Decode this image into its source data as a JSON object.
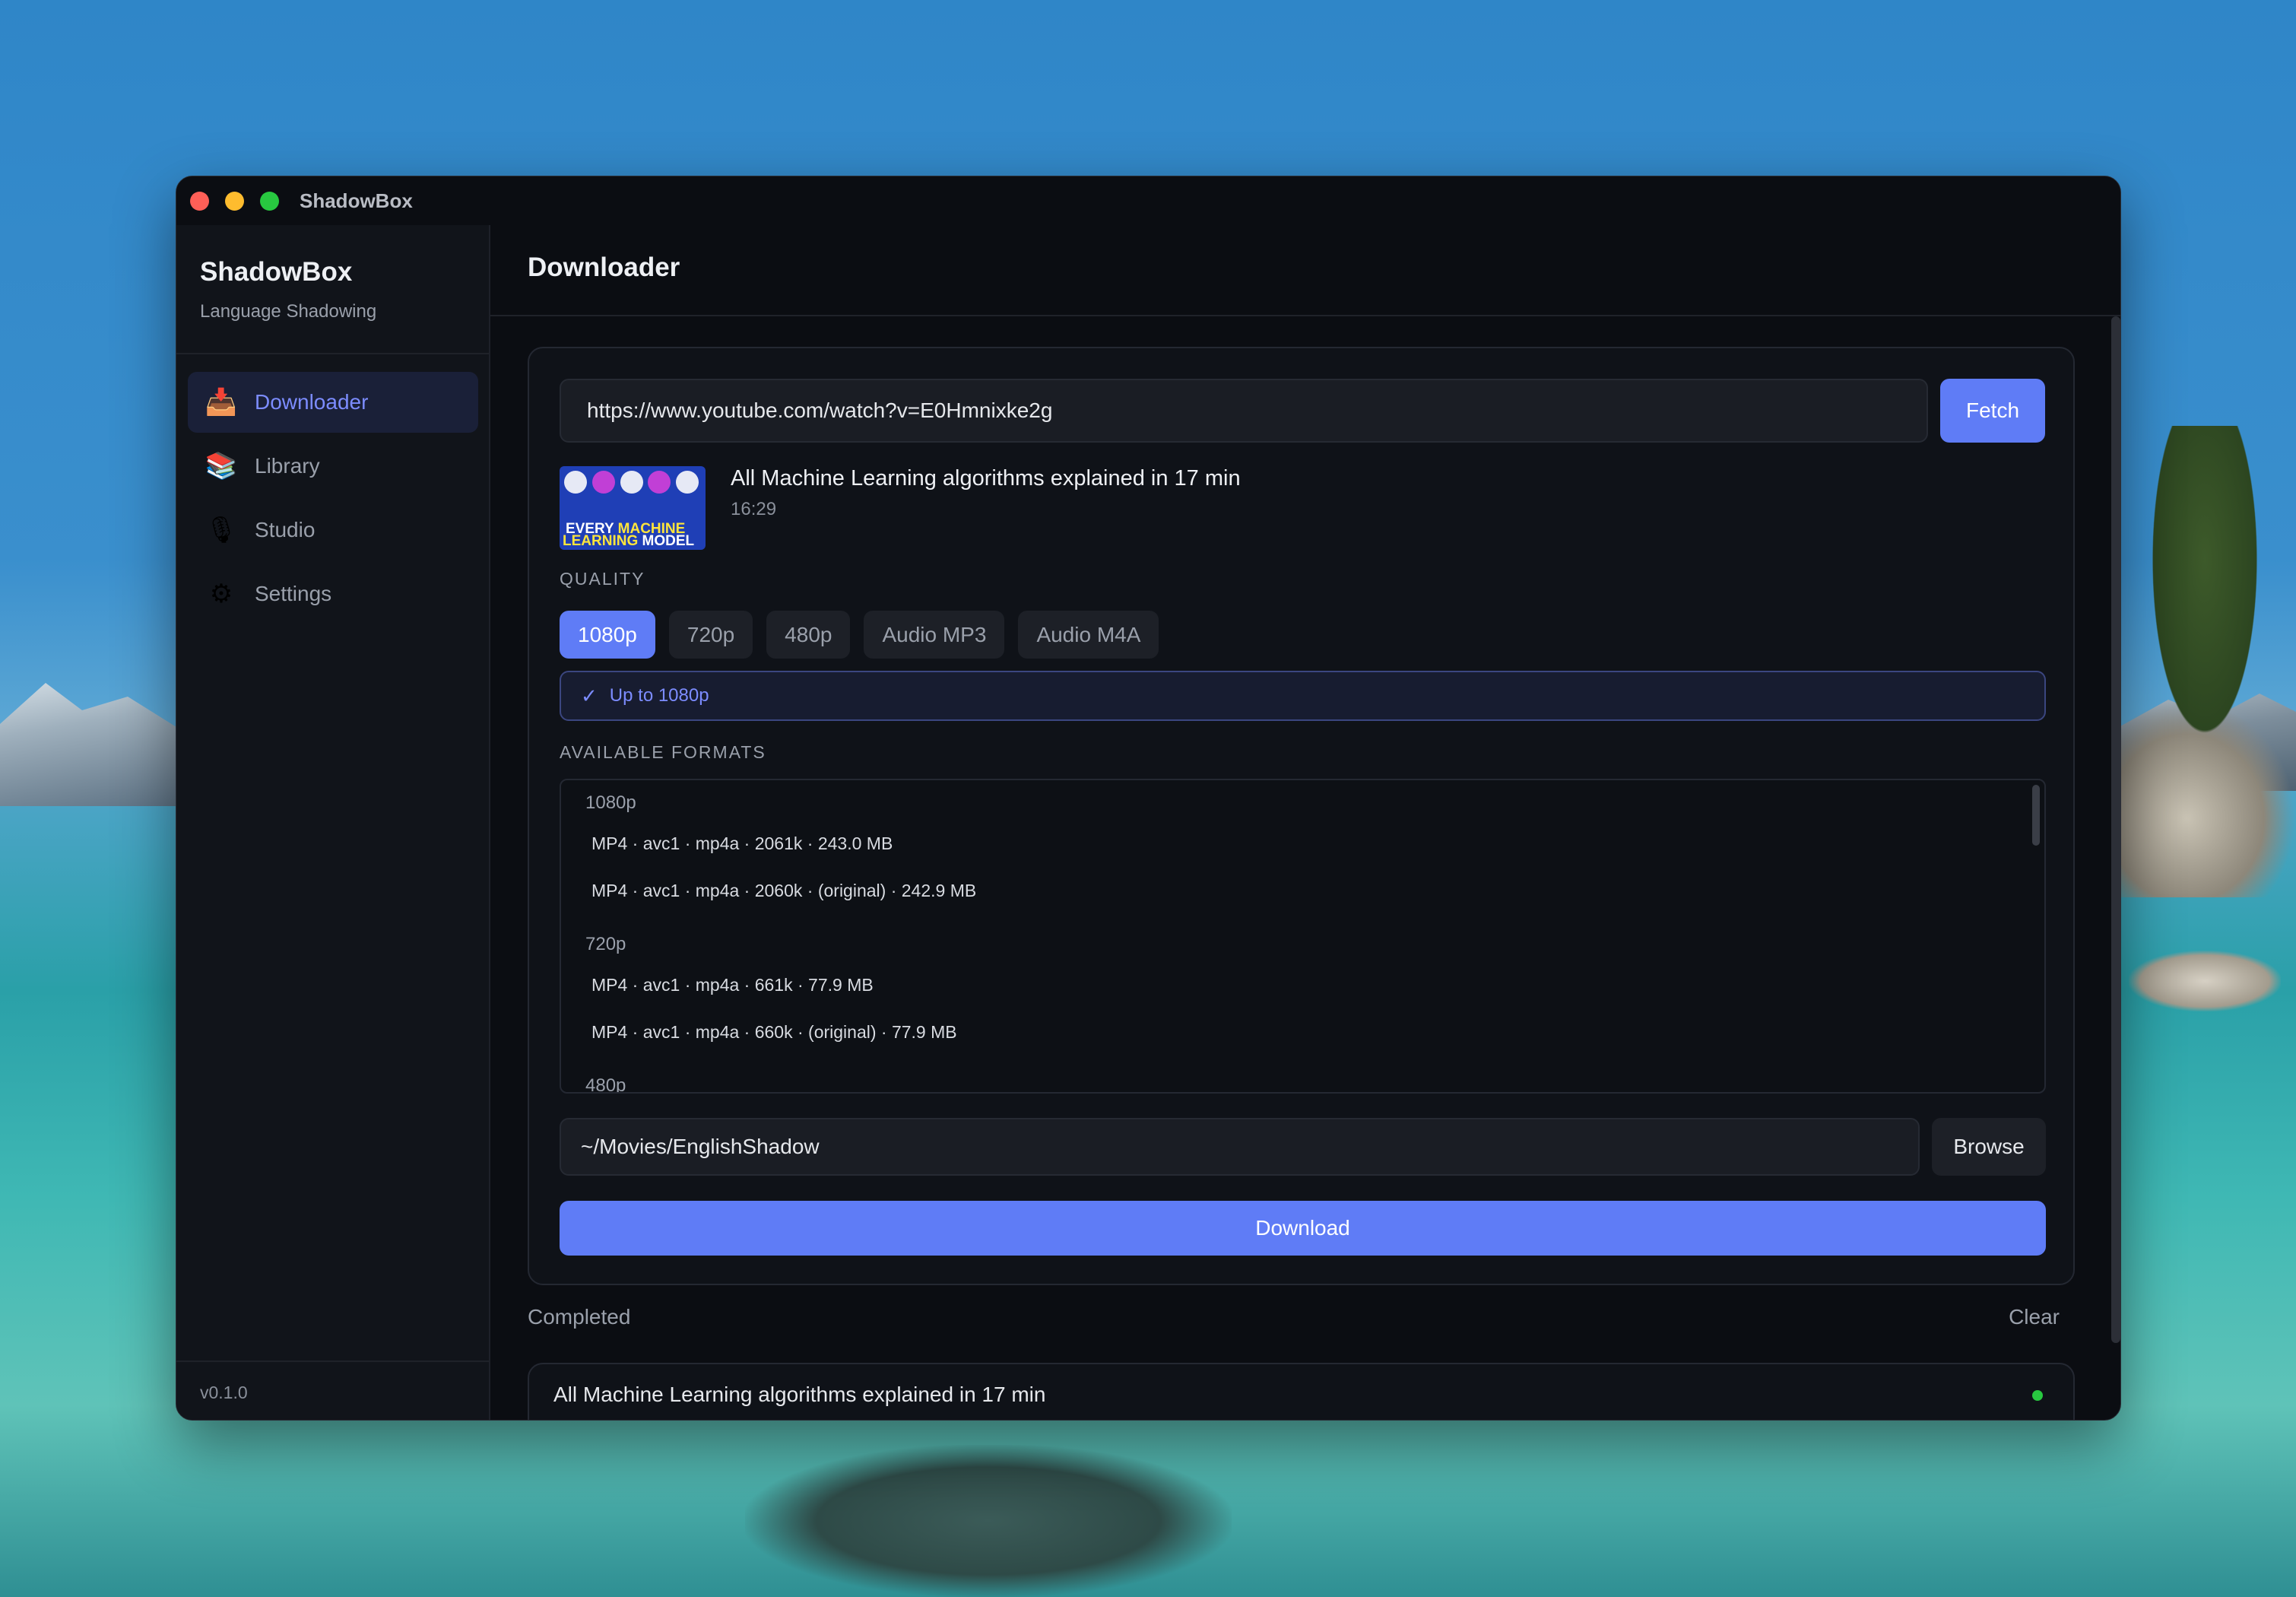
{
  "window": {
    "title": "ShadowBox"
  },
  "sidebar": {
    "brand": "ShadowBox",
    "subtitle": "Language Shadowing",
    "items": [
      {
        "label": "Downloader",
        "icon": "inbox-tray-icon",
        "active": true
      },
      {
        "label": "Library",
        "icon": "books-icon",
        "active": false
      },
      {
        "label": "Studio",
        "icon": "microphone-icon",
        "active": false
      },
      {
        "label": "Settings",
        "icon": "gear-icon",
        "active": false
      }
    ],
    "version": "v0.1.0"
  },
  "main": {
    "title": "Downloader",
    "url_value": "https://www.youtube.com/watch?v=E0Hmnixke2g",
    "fetch_label": "Fetch",
    "video": {
      "title": "All Machine Learning algorithms explained in 17 min",
      "duration": "16:29",
      "thumbnail_text_line1a": "EVERY",
      "thumbnail_text_line1b": "MACHINE",
      "thumbnail_text_line2a": "LEARNING",
      "thumbnail_text_line2b": "MODEL"
    },
    "quality_label": "QUALITY",
    "quality_options": [
      "1080p",
      "720p",
      "480p",
      "Audio MP3",
      "Audio M4A"
    ],
    "quality_selected": "1080p",
    "quality_note": "Up to 1080p",
    "formats_label": "AVAILABLE FORMATS",
    "format_groups": [
      {
        "name": "1080p",
        "items": [
          "MP4 · avc1 · mp4a · 2061k · 243.0 MB",
          "MP4 · avc1 · mp4a · 2060k · (original) · 242.9 MB"
        ]
      },
      {
        "name": "720p",
        "items": [
          "MP4 · avc1 · mp4a · 661k · 77.9 MB",
          "MP4 · avc1 · mp4a · 660k · (original) · 77.9 MB"
        ]
      },
      {
        "name": "480p",
        "items": []
      }
    ],
    "output_path": "~/Movies/EnglishShadow",
    "browse_label": "Browse",
    "download_label": "Download",
    "completed_label": "Completed",
    "clear_label": "Clear",
    "completed_items": [
      {
        "title": "All Machine Learning algorithms explained in 17 min",
        "status_color": "#28c840"
      }
    ]
  },
  "colors": {
    "accent": "#5f7cf6",
    "accent_text": "#7c8cff",
    "success": "#28c840"
  }
}
